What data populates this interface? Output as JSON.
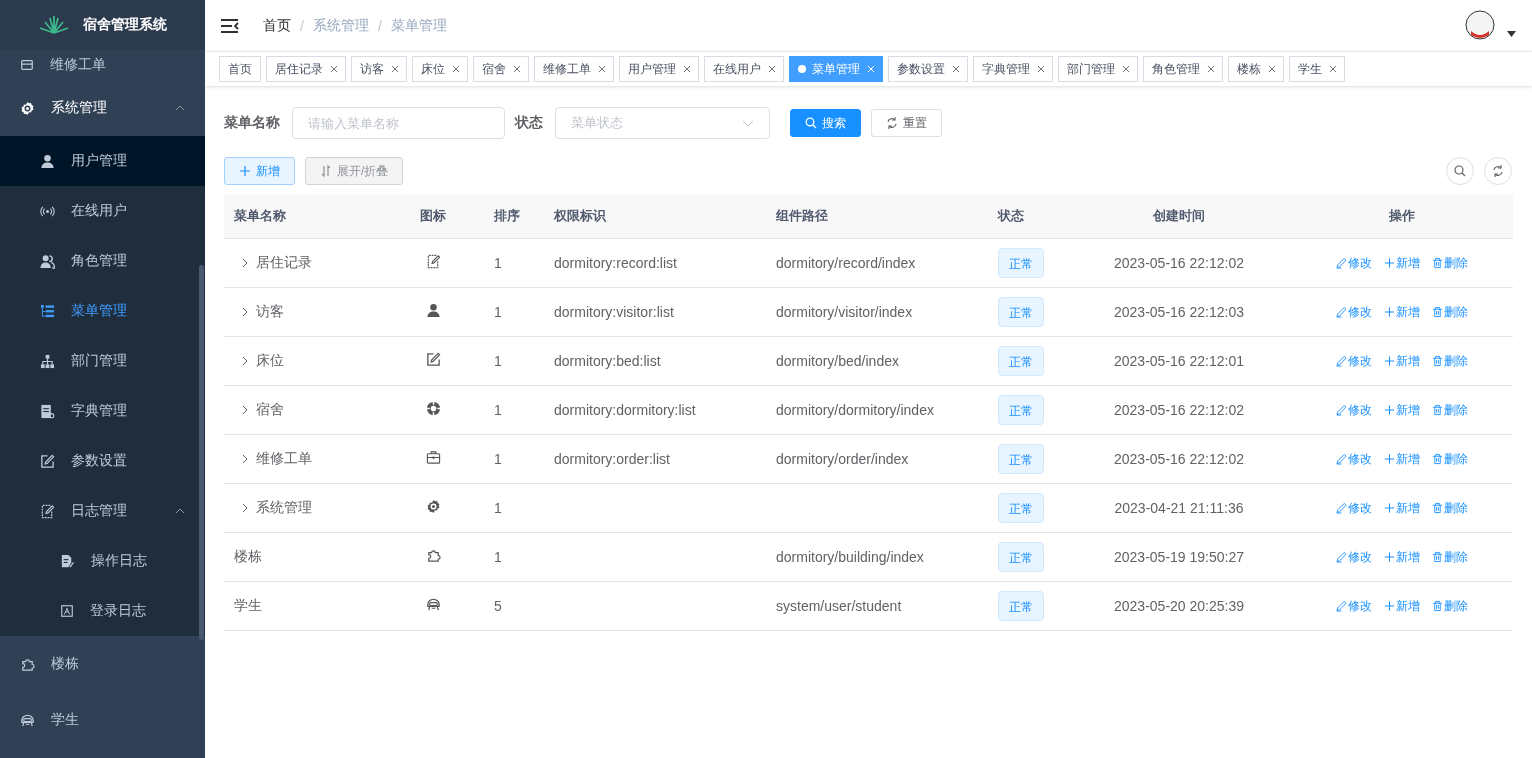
{
  "sidebar": {
    "title": "宿舍管理系统",
    "items": [
      {
        "label": "维修工单",
        "selected": false,
        "hovered": false
      },
      {
        "label": "系统管理",
        "selected": true,
        "hovered": false,
        "expanded": true,
        "children": [
          {
            "label": "用户管理",
            "selected": false,
            "hovered": true
          },
          {
            "label": "在线用户",
            "selected": false,
            "hovered": false
          },
          {
            "label": "角色管理",
            "selected": false,
            "hovered": false
          },
          {
            "label": "菜单管理",
            "selected": true,
            "hovered": false
          },
          {
            "label": "部门管理",
            "selected": false,
            "hovered": false
          },
          {
            "label": "字典管理",
            "selected": false,
            "hovered": false
          },
          {
            "label": "参数设置",
            "selected": false,
            "hovered": false
          },
          {
            "label": "日志管理",
            "selected": false,
            "hovered": false,
            "expanded": true,
            "children": [
              {
                "label": "操作日志",
                "selected": false,
                "hovered": false
              },
              {
                "label": "登录日志",
                "selected": false,
                "hovered": false
              }
            ]
          }
        ]
      },
      {
        "label": "楼栋",
        "selected": false,
        "hovered": false
      },
      {
        "label": "学生",
        "selected": false,
        "hovered": false
      }
    ]
  },
  "header": {
    "breadcrumb": [
      "首页",
      "系统管理",
      "菜单管理"
    ],
    "breadcrumb_separator": "/"
  },
  "tags": [
    {
      "label": "首页",
      "closable": false,
      "selected": false
    },
    {
      "label": "居住记录",
      "closable": true,
      "selected": false
    },
    {
      "label": "访客",
      "closable": true,
      "selected": false
    },
    {
      "label": "床位",
      "closable": true,
      "selected": false
    },
    {
      "label": "宿舍",
      "closable": true,
      "selected": false
    },
    {
      "label": "维修工单",
      "closable": true,
      "selected": false
    },
    {
      "label": "用户管理",
      "closable": true,
      "selected": false
    },
    {
      "label": "在线用户",
      "closable": true,
      "selected": false
    },
    {
      "label": "菜单管理",
      "closable": true,
      "selected": true
    },
    {
      "label": "参数设置",
      "closable": true,
      "selected": false
    },
    {
      "label": "字典管理",
      "closable": true,
      "selected": false
    },
    {
      "label": "部门管理",
      "closable": true,
      "selected": false
    },
    {
      "label": "角色管理",
      "closable": true,
      "selected": false
    },
    {
      "label": "楼栋",
      "closable": true,
      "selected": false
    },
    {
      "label": "学生",
      "closable": true,
      "selected": false
    }
  ],
  "search": {
    "fields": [
      {
        "label": "菜单名称",
        "kind": "input",
        "placeholder": "请输入菜单名称"
      },
      {
        "label": "状态",
        "kind": "select",
        "placeholder": "菜单状态"
      }
    ],
    "buttons": [
      {
        "label": "搜索",
        "kind": "primary"
      },
      {
        "label": "重置",
        "kind": "default"
      }
    ]
  },
  "toolbar": {
    "buttons": [
      {
        "label": "新增",
        "kind": "add"
      },
      {
        "label": "展开/折叠",
        "kind": "toggle"
      }
    ]
  },
  "table": {
    "columns": [
      "菜单名称",
      "图标",
      "排序",
      "权限标识",
      "组件路径",
      "状态",
      "创建时间",
      "操作"
    ],
    "rows": [
      {
        "name": "居住记录",
        "expandable": true,
        "sort": "1",
        "permission": "dormitory:record:list",
        "component": "dormitory/record/index",
        "status": "正常",
        "created": "2023-05-16 22:12:02",
        "actions": [
          "修改",
          "新增",
          "删除"
        ]
      },
      {
        "name": "访客",
        "expandable": true,
        "sort": "1",
        "permission": "dormitory:visitor:list",
        "component": "dormitory/visitor/index",
        "status": "正常",
        "created": "2023-05-16 22:12:03",
        "actions": [
          "修改",
          "新增",
          "删除"
        ]
      },
      {
        "name": "床位",
        "expandable": true,
        "sort": "1",
        "permission": "dormitory:bed:list",
        "component": "dormitory/bed/index",
        "status": "正常",
        "created": "2023-05-16 22:12:01",
        "actions": [
          "修改",
          "新增",
          "删除"
        ]
      },
      {
        "name": "宿舍",
        "expandable": true,
        "sort": "1",
        "permission": "dormitory:dormitory:list",
        "component": "dormitory/dormitory/index",
        "status": "正常",
        "created": "2023-05-16 22:12:02",
        "actions": [
          "修改",
          "新增",
          "删除"
        ]
      },
      {
        "name": "维修工单",
        "expandable": true,
        "sort": "1",
        "permission": "dormitory:order:list",
        "component": "dormitory/order/index",
        "status": "正常",
        "created": "2023-05-16 22:12:02",
        "actions": [
          "修改",
          "新增",
          "删除"
        ]
      },
      {
        "name": "系统管理",
        "expandable": true,
        "sort": "1",
        "status": "正常",
        "created": "2023-04-21 21:11:36",
        "actions": [
          "修改",
          "新增",
          "删除"
        ]
      },
      {
        "name": "楼栋",
        "expandable": false,
        "sort": "1",
        "component": "dormitory/building/index",
        "status": "正常",
        "created": "2023-05-19 19:50:27",
        "actions": [
          "修改",
          "新增",
          "删除"
        ]
      },
      {
        "name": "学生",
        "expandable": false,
        "sort": "5",
        "component": "system/user/student",
        "status": "正常",
        "created": "2023-05-20 20:25:39",
        "actions": [
          "修改",
          "新增",
          "删除"
        ]
      }
    ]
  }
}
